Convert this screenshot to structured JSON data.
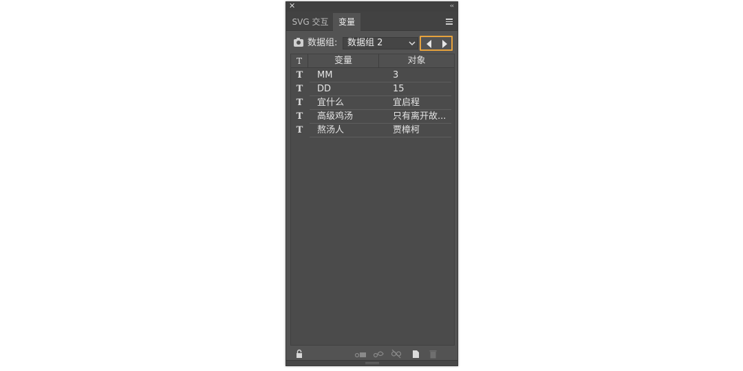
{
  "window": {
    "close_glyph": "✕",
    "collapse_glyph": "‹‹"
  },
  "tabs": [
    {
      "label": "SVG 交互",
      "active": false
    },
    {
      "label": "变量",
      "active": true
    }
  ],
  "dataset": {
    "label": "数据组:",
    "selected": "数据组 2"
  },
  "table": {
    "headers": {
      "type": "T",
      "variable": "变量",
      "object": "对象"
    },
    "rows": [
      {
        "type": "T",
        "name": "MM",
        "object": "3"
      },
      {
        "type": "T",
        "name": "DD",
        "object": "15"
      },
      {
        "type": "T",
        "name": "宜什么",
        "object": "宜启程"
      },
      {
        "type": "T",
        "name": "高级鸡汤",
        "object": "只有离开故..."
      },
      {
        "type": "T",
        "name": "熬汤人",
        "object": "贾樟柯"
      }
    ]
  },
  "icons": {
    "camera": "camera-icon",
    "chevron": "chevron-down-icon",
    "prev": "triangle-left-icon",
    "next": "triangle-right-icon",
    "menu": "hamburger-menu-icon",
    "lock": "lock-icon",
    "bind": "make-visibility-dynamic-icon",
    "dynamic": "make-object-dynamic-icon",
    "unbind": "unbind-variable-icon",
    "new": "new-variable-icon",
    "trash": "trash-icon"
  },
  "colors": {
    "panel_bg": "#535353",
    "highlight": "#e8a33d",
    "text": "#e4e4e4"
  }
}
